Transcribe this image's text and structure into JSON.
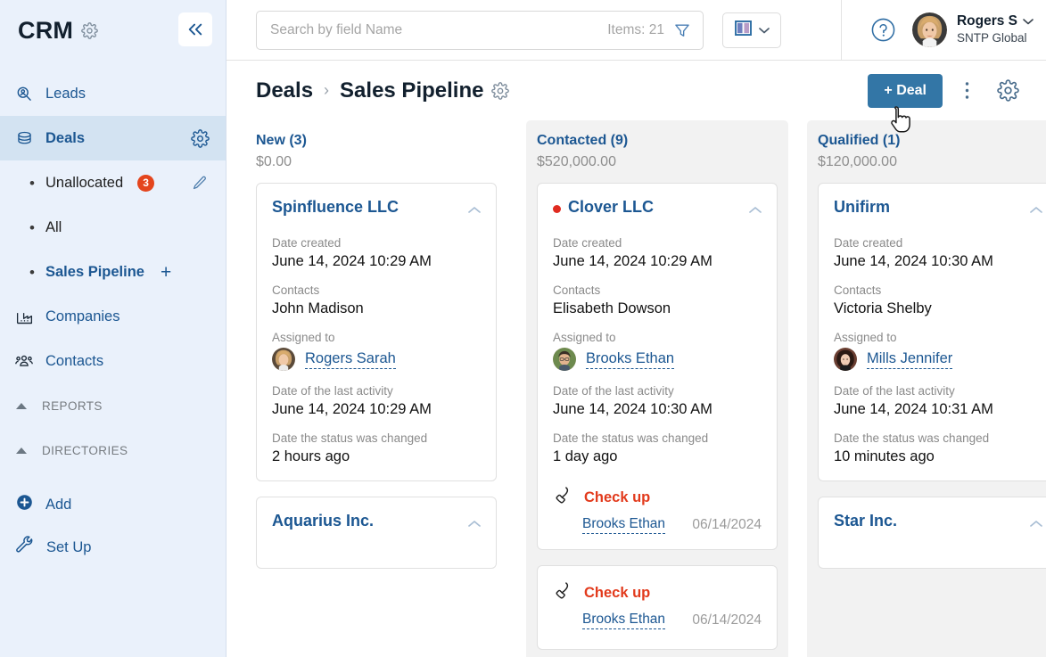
{
  "sidebar": {
    "brand": "CRM",
    "brand_gear_icon": "gear-icon",
    "collapse_icon": "chevron-double-left-icon",
    "items": [
      {
        "label": "Leads",
        "icon": "leads-search-icon"
      },
      {
        "label": "Deals",
        "icon": "deals-stack-icon",
        "trailing_icon": "gear-icon"
      }
    ],
    "sub_items": [
      {
        "label": "Unallocated",
        "badge": "3",
        "trailing_icon": "pencil-icon"
      },
      {
        "label": "All"
      },
      {
        "label": "Sales Pipeline",
        "trailing_icon": "plus-icon"
      }
    ],
    "items2": [
      {
        "label": "Companies",
        "icon": "companies-factory-icon"
      },
      {
        "label": "Contacts",
        "icon": "contacts-people-icon"
      }
    ],
    "sections": [
      {
        "label": "REPORTS",
        "caret": "caret-up-icon"
      },
      {
        "label": "DIRECTORIES",
        "caret": "caret-up-icon"
      }
    ],
    "bottom": [
      {
        "label": "Add",
        "icon": "plus-circle-icon"
      },
      {
        "label": "Set Up",
        "icon": "wrench-icon"
      }
    ]
  },
  "topbar": {
    "search_placeholder": "Search by field Name",
    "search_value": "",
    "items_count": "Items: 21",
    "filter_icon": "funnel-icon",
    "view_icon": "columns-view-icon",
    "view_chevron": "chevron-down-icon",
    "help_icon": "question-circle-icon",
    "user_name": "Rogers S",
    "user_org": "SNTP Global",
    "user_chevron": "chevron-down-icon"
  },
  "titlebar": {
    "crumb_parent": "Deals",
    "crumb_sep": "›",
    "crumb_current": "Sales Pipeline",
    "crumb_gear_icon": "gear-icon",
    "add_deal_label": "+ Deal",
    "more_icon": "kebab-menu-icon",
    "settings_icon": "gear-icon"
  },
  "colors": {
    "accent_blue": "#1c5792",
    "button_blue": "#3376a6",
    "badge_red": "#e4451d",
    "task_red": "#e23a1c",
    "sidebar_bg": "#eaf1fb",
    "sidebar_active": "#d3e3f2",
    "column_bg": "#f2f2f2"
  },
  "labels": {
    "date_created": "Date created",
    "contacts": "Contacts",
    "assigned_to": "Assigned to",
    "last_activity": "Date of the last activity",
    "status_changed": "Date the status was changed"
  },
  "board": {
    "columns": [
      {
        "title": "New (3)",
        "sum": "$0.00",
        "highlighted": false,
        "cards": [
          {
            "title": "Spinfluence LLC",
            "has_dot": false,
            "date_created": "June 14, 2024 10:29 AM",
            "contact": "John Madison",
            "assignee": "Rogers Sarah",
            "last_activity": "June 14, 2024 10:29 AM",
            "status_changed": "2 hours ago",
            "task": null
          },
          {
            "title": "Aquarius Inc.",
            "partial": true
          }
        ]
      },
      {
        "title": "Contacted (9)",
        "sum": "$520,000.00",
        "highlighted": true,
        "cards": [
          {
            "title": "Clover LLC",
            "has_dot": true,
            "date_created": "June 14, 2024 10:29 AM",
            "contact": "Elisabeth Dowson",
            "assignee": "Brooks Ethan",
            "last_activity": "June 14, 2024 10:30 AM",
            "status_changed": "1 day ago",
            "task": {
              "icon": "phone-call-icon",
              "name": "Check up",
              "user": "Brooks Ethan",
              "date": "06/14/2024"
            }
          },
          {
            "title": "",
            "partial_task": true,
            "task": {
              "icon": "phone-call-icon",
              "name": "Check up",
              "user": "Brooks Ethan",
              "date": "06/14/2024"
            }
          }
        ]
      },
      {
        "title": "Qualified (1)",
        "sum": "$120,000.00",
        "highlighted": true,
        "cards": [
          {
            "title": "Unifirm",
            "has_dot": false,
            "date_created": "June 14, 2024 10:30 AM",
            "contact": "Victoria Shelby",
            "assignee": "Mills Jennifer",
            "last_activity": "June 14, 2024 10:31 AM",
            "status_changed": "10 minutes ago",
            "task": null
          },
          {
            "title": "Star Inc.",
            "partial": true
          }
        ]
      }
    ]
  }
}
